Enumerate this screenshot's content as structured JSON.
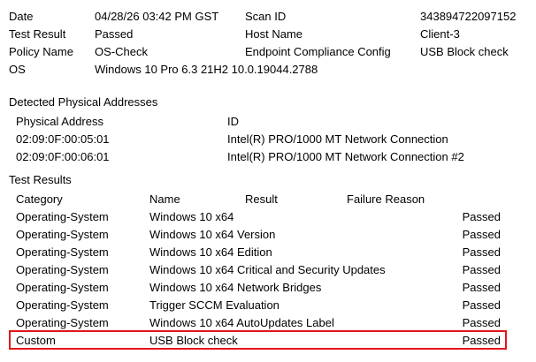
{
  "summary": {
    "date_label": "Date",
    "date_value": "04/28/26 03:42 PM GST",
    "scan_id_label": "Scan ID",
    "scan_id_value": "343894722097152",
    "test_result_label": "Test Result",
    "test_result_value": "Passed",
    "host_name_label": "Host Name",
    "host_name_value": "Client-3",
    "policy_name_label": "Policy Name",
    "policy_name_value": "OS-Check",
    "policy_type_value": "Endpoint Compliance Config",
    "policy_check_value": "USB Block check",
    "os_label": "OS",
    "os_value": "Windows 10 Pro 6.3 21H2 10.0.19044.2788"
  },
  "addresses": {
    "section_title": "Detected Physical Addresses",
    "col_address": "Physical Address",
    "col_id": "ID",
    "rows": [
      {
        "address": "02:09:0F:00:05:01",
        "id": "Intel(R) PRO/1000 MT Network Connection"
      },
      {
        "address": "02:09:0F:00:06:01",
        "id": "Intel(R) PRO/1000 MT Network Connection #2"
      }
    ]
  },
  "tests": {
    "section_title": "Test Results",
    "col_category": "Category",
    "col_name": "Name",
    "col_result": "Result",
    "col_failure": "Failure Reason",
    "rows": [
      {
        "category": "Operating-System",
        "name": "Windows 10 x64",
        "result": "Passed"
      },
      {
        "category": "Operating-System",
        "name": "Windows 10 x64 Version",
        "result": "Passed"
      },
      {
        "category": "Operating-System",
        "name": "Windows 10 x64 Edition",
        "result": "Passed"
      },
      {
        "category": "Operating-System",
        "name": "Windows 10 x64 Critical and Security Updates",
        "result": "Passed"
      },
      {
        "category": "Operating-System",
        "name": "Windows 10 x64 Network Bridges",
        "result": "Passed"
      },
      {
        "category": "Operating-System",
        "name": "Trigger SCCM Evaluation",
        "result": "Passed"
      },
      {
        "category": "Operating-System",
        "name": "Windows 10 x64 AutoUpdates Label",
        "result": "Passed"
      },
      {
        "category": "Custom",
        "name": "USB Block check",
        "result": "Passed"
      }
    ]
  },
  "colors": {
    "highlight_border": "#e3141c",
    "text": "#000000"
  }
}
